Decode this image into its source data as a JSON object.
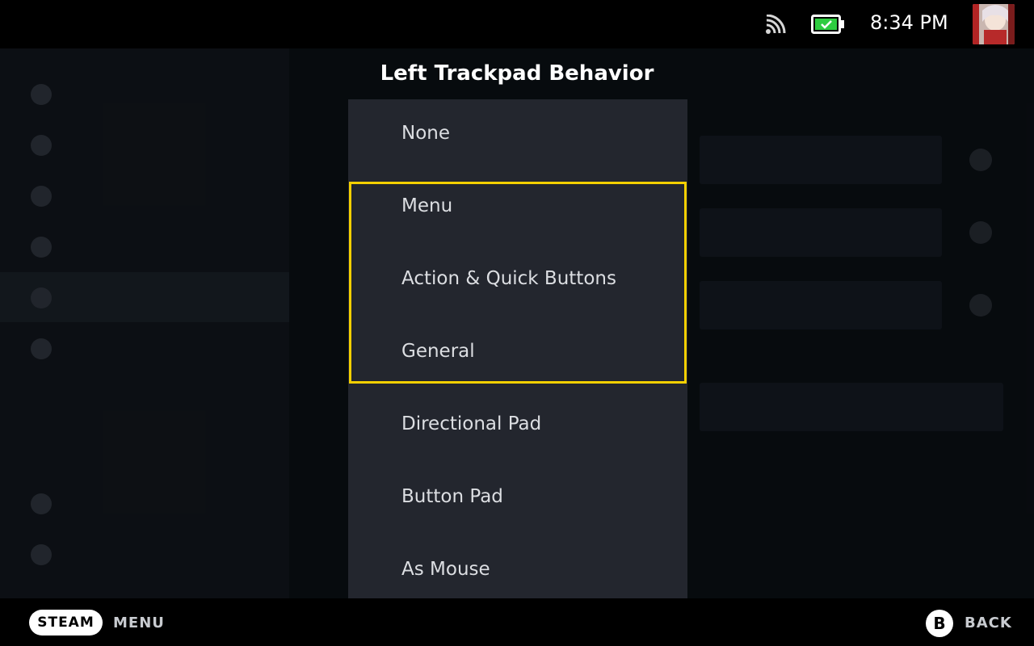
{
  "status_bar": {
    "time": "8:34 PM",
    "signal_icon": "wifi-signal-icon",
    "battery_icon": "battery-charging-icon",
    "battery_color": "#2ecc40",
    "avatar": "user-avatar"
  },
  "modal": {
    "title": "Left Trackpad Behavior",
    "options": [
      {
        "label": "None"
      },
      {
        "label": "Menu"
      },
      {
        "label": "Action & Quick Buttons"
      },
      {
        "label": "General"
      },
      {
        "label": "Directional Pad"
      },
      {
        "label": "Button Pad"
      },
      {
        "label": "As Mouse"
      }
    ],
    "focus_color": "#f5d000"
  },
  "footer": {
    "steam_label": "STEAM",
    "menu_label": "MENU",
    "b_label": "B",
    "back_label": "BACK"
  }
}
